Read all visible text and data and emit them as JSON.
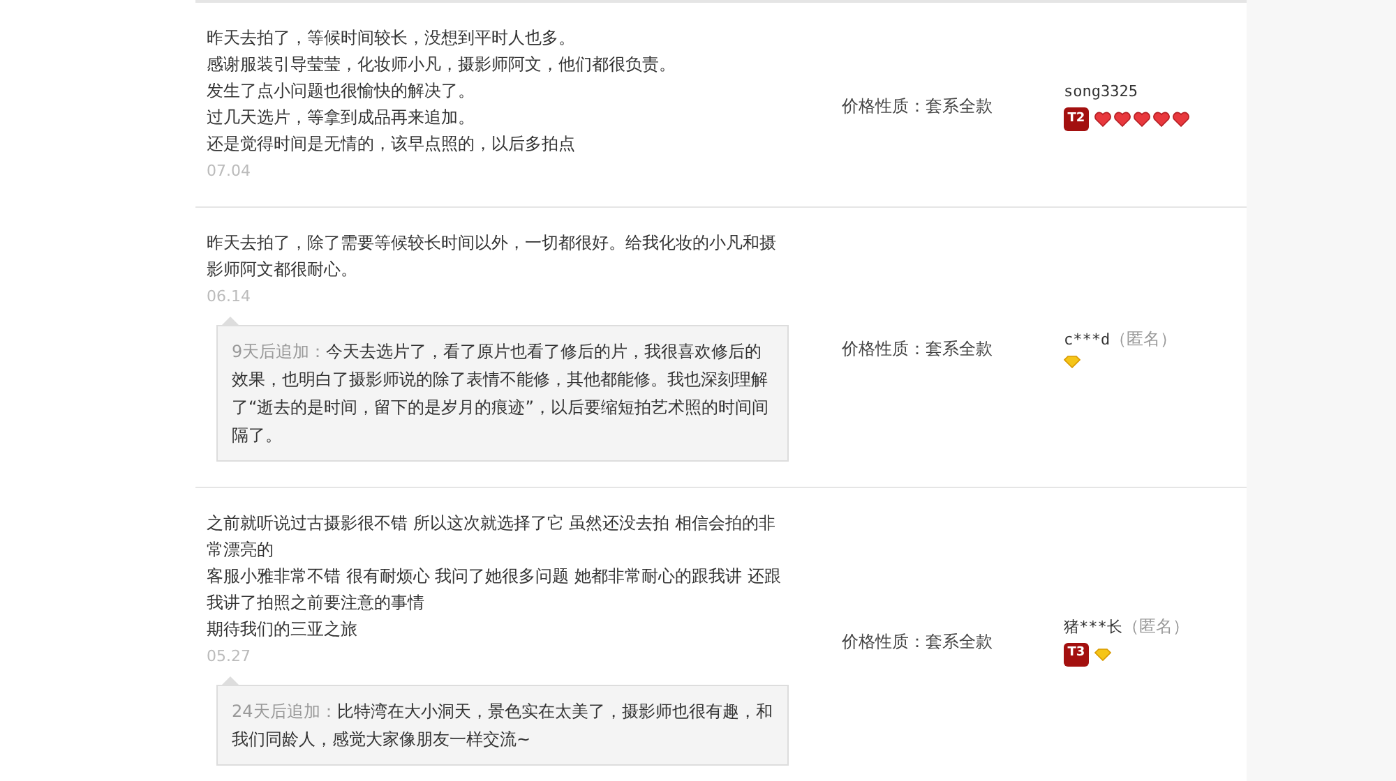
{
  "reviews": [
    {
      "lines": [
        "昨天去拍了，等候时间较长，没想到平时人也多。",
        "感谢服装引导莹莹，化妆师小凡，摄影师阿文，他们都很负责。",
        "发生了点小问题也很愉快的解决了。",
        "过几天选片，等拿到成品再来追加。",
        "还是觉得时间是无情的，该早点照的，以后多拍点"
      ],
      "date": "07.04",
      "price": "价格性质：套系全款",
      "user": {
        "name": "song3325",
        "badge": "T2",
        "rank": [
          {
            "kind": "heart"
          },
          {
            "kind": "heart"
          },
          {
            "kind": "heart"
          },
          {
            "kind": "heart"
          },
          {
            "kind": "heart"
          }
        ]
      }
    },
    {
      "lines": [
        "昨天去拍了，除了需要等候较长时间以外，一切都很好。给我化妆的小凡和摄影师阿文都很耐心。"
      ],
      "date": "06.14",
      "followup": {
        "prefix": "9天后追加：",
        "text": "今天去选片了，看了原片也看了修后的片，我很喜欢修后的效果，也明白了摄影师说的除了表情不能修，其他都能修。我也深刻理解了“逝去的是时间，留下的是岁月的痕迹”，以后要缩短拍艺术照的时间间隔了。"
      },
      "price": "价格性质：套系全款",
      "user": {
        "name": "c***d",
        "anonymous": "（匿名）",
        "rank": [
          {
            "kind": "diamond"
          }
        ]
      }
    },
    {
      "lines": [
        "之前就听说过古摄影很不错 所以这次就选择了它 虽然还没去拍 相信会拍的非常漂亮的",
        "客服小雅非常不错 很有耐烦心 我问了她很多问题 她都非常耐心的跟我讲 还跟我讲了拍照之前要注意的事情",
        "期待我们的三亚之旅"
      ],
      "date": "05.27",
      "followup": {
        "prefix": "24天后追加：",
        "text": "比特湾在大小洞天，景色实在太美了，摄影师也很有趣，和我们同龄人，感觉大家像朋友一样交流~"
      },
      "price": "价格性质：套系全款",
      "user": {
        "name": "猪***长",
        "anonymous": "（匿名）",
        "badge": "T3",
        "rank": [
          {
            "kind": "diamond"
          }
        ]
      }
    }
  ]
}
